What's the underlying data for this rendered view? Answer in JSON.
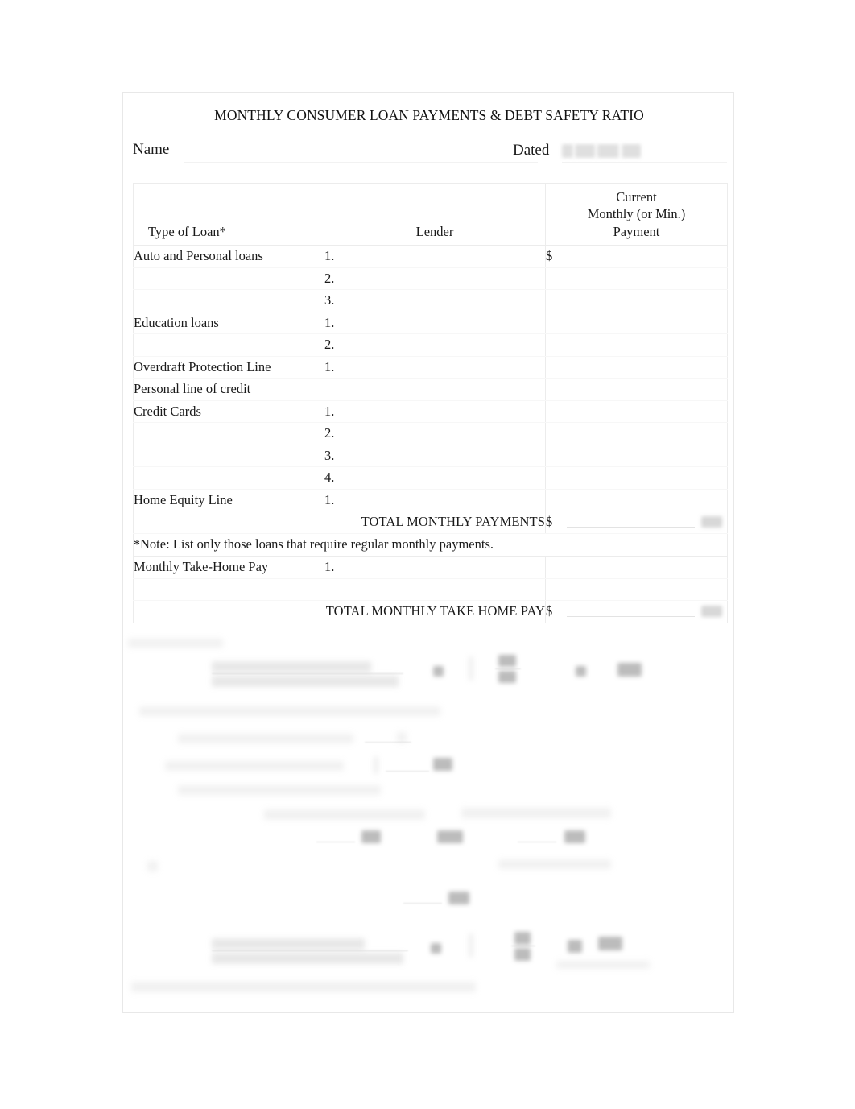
{
  "document": {
    "title": "MONTHLY CONSUMER LOAN PAYMENTS & DEBT SAFETY RATIO",
    "name_label": "Name",
    "name_value": "",
    "dated_label": "Dated",
    "dated_value": ""
  },
  "table": {
    "headers": {
      "type_of_loan": "Type of Loan*",
      "lender": "Lender",
      "payment_line1": "Current",
      "payment_line2": "Monthly (or Min.)",
      "payment_line3": "Payment"
    },
    "rows": [
      {
        "type": "Auto and Personal loans",
        "item": "1.",
        "payment_prefix": "$",
        "payment": ""
      },
      {
        "type": "",
        "item": "2.",
        "payment_prefix": "",
        "payment": ""
      },
      {
        "type": "",
        "item": "3.",
        "payment_prefix": "",
        "payment": ""
      },
      {
        "type": "Education loans",
        "item": "1.",
        "payment_prefix": "",
        "payment": ""
      },
      {
        "type": "",
        "item": "2.",
        "payment_prefix": "",
        "payment": ""
      },
      {
        "type": "Overdraft Protection Line",
        "item": "1.",
        "payment_prefix": "",
        "payment": ""
      },
      {
        "type": "Personal line of credit",
        "item": "",
        "payment_prefix": "",
        "payment": ""
      },
      {
        "type": "Credit Cards",
        "item": "1.",
        "payment_prefix": "",
        "payment": ""
      },
      {
        "type": "",
        "item": "2.",
        "payment_prefix": "",
        "payment": ""
      },
      {
        "type": "",
        "item": "3.",
        "payment_prefix": "",
        "payment": ""
      },
      {
        "type": "",
        "item": "4.",
        "payment_prefix": "",
        "payment": ""
      },
      {
        "type": "Home Equity Line",
        "item": "1.",
        "payment_prefix": "",
        "payment": ""
      }
    ],
    "total_payments": {
      "label": "TOTAL MONTHLY PAYMENTS",
      "prefix": "$",
      "value": ""
    },
    "note": {
      "star": "*",
      "text": "Note:  List only those loans that require regular monthly payments."
    },
    "take_home_rows": [
      {
        "type": "Monthly Take-Home Pay",
        "item": "1.",
        "payment": ""
      },
      {
        "type": "",
        "item": "",
        "payment": ""
      }
    ],
    "total_take_home": {
      "label": "TOTAL MONTHLY TAKE HOME PAY",
      "prefix": "$",
      "value": ""
    }
  },
  "redacted_section": {
    "description": "Debt safety ratio calculation worksheet — content illegible / blurred in source image",
    "legible_text": ""
  }
}
